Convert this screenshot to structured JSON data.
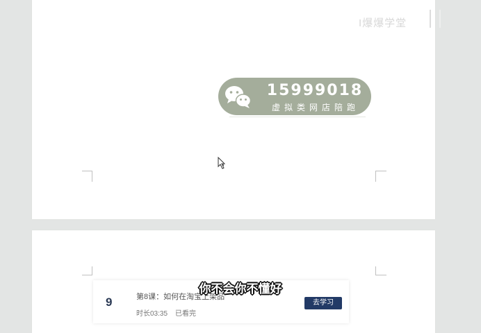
{
  "watermark": {
    "top_right_text": "I爆爆学堂"
  },
  "contact_badge": {
    "icon": "wechat-icon",
    "number": "15999018",
    "subtitle": "虚拟类网店陪跑"
  },
  "lesson": {
    "number": "9",
    "title": "第8课：如何在淘宝上架品",
    "duration": "时长03:35",
    "status": "已看完",
    "button_label": "去学习",
    "button_color": "#223a66"
  },
  "subtitle": "你不会你不懂好",
  "colors": {
    "background": "#e3e5e4",
    "page": "#ffffff",
    "badge": "#a4ad9b"
  }
}
